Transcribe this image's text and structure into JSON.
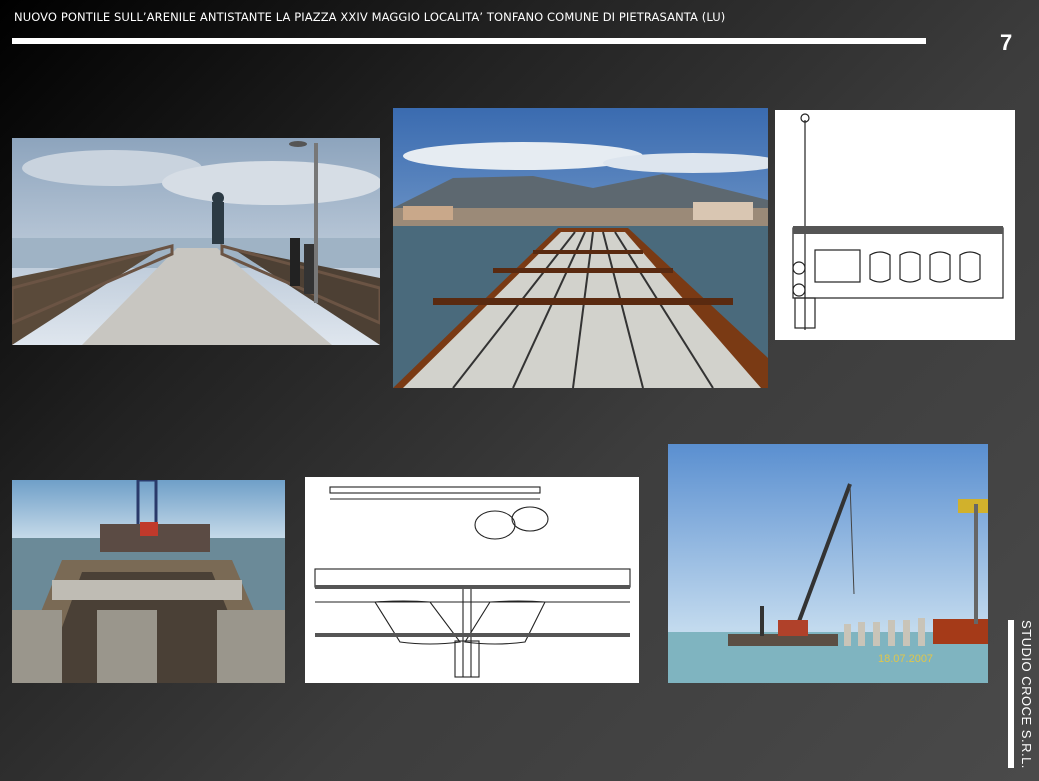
{
  "header": {
    "title": "NUOVO PONTILE SULL’ARENILE ANTISTANTE LA PIAZZA XXIV MAGGIO  LOCALITA’  TONFANO COMUNE DI PIETRASANTA (LU)",
    "page_number": "7"
  },
  "photos": {
    "completed_pier": {
      "icon": "statue-on-pier"
    },
    "pier_deck_construction": {
      "icon": "precast-deck-slabs"
    },
    "section_drawing_1": {
      "icon": "cross-section-drawing"
    },
    "barge_deck_assembly": {
      "icon": "barge-with-crane"
    },
    "section_drawing_2": {
      "icon": "beam-detail-drawing"
    },
    "crane_barge_piles": {
      "icon": "crawler-crane-on-barge",
      "timestamp": "18.07.2007"
    }
  },
  "footer": {
    "credit": "STUDIO CROCE S.R.L."
  },
  "colors": {
    "background_dark": "#000000",
    "background_light": "#4a4a4a",
    "sea": "#6fa6b8",
    "rust": "#8b3b16"
  }
}
